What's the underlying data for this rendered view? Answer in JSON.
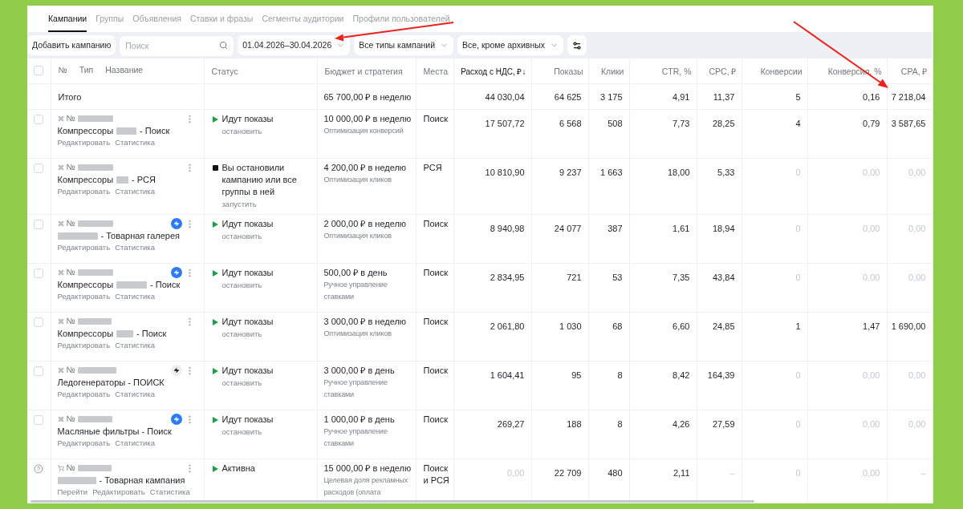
{
  "tabs": [
    {
      "label": "Кампании",
      "selected": true
    },
    {
      "label": "Группы",
      "selected": false
    },
    {
      "label": "Объявления",
      "selected": false
    },
    {
      "label": "Ставки и фразы",
      "selected": false
    },
    {
      "label": "Сегменты аудитории",
      "selected": false
    },
    {
      "label": "Профили пользователей",
      "selected": false
    }
  ],
  "toolbar": {
    "add_button": "Добавить кампанию",
    "search": {
      "placeholder": "Поиск"
    },
    "filters": [
      {
        "label": "01.04.2026–30.04.2026"
      },
      {
        "label": "Все типы кампаний"
      },
      {
        "label": "Все, кроме архивных"
      }
    ]
  },
  "table": {
    "all_checked": false,
    "name_column_labels": [
      "№",
      "Тип",
      "Название"
    ],
    "columns": [
      {
        "label": "Статус",
        "sorted": false
      },
      {
        "label": "Бюджет и стратегия",
        "sorted": false
      },
      {
        "label": "Места",
        "sorted": false
      },
      {
        "label": "Расход с НДС, ₽↓",
        "sorted": true
      },
      {
        "label": "Показы",
        "sorted": false
      },
      {
        "label": "Клики",
        "sorted": false
      },
      {
        "label": "CTR, %",
        "sorted": false
      },
      {
        "label": "CPC, ₽",
        "sorted": false
      },
      {
        "label": "Конверсии",
        "sorted": false
      },
      {
        "label": "Конверсия, %",
        "sorted": false
      },
      {
        "label": "CPA, ₽",
        "sorted": false
      }
    ],
    "totals": {
      "label": "Итого",
      "budget": "65 700,00 ₽ в неделю",
      "metrics": [
        {
          "text": "44 030,04",
          "muted": false
        },
        {
          "text": "64 625",
          "muted": false
        },
        {
          "text": "3 175",
          "muted": false
        },
        {
          "text": "4,91",
          "muted": false
        },
        {
          "text": "11,37",
          "muted": false
        },
        {
          "text": "5",
          "muted": false
        },
        {
          "text": "0,16",
          "muted": false
        },
        {
          "text": "7 218,04",
          "muted": false
        }
      ]
    },
    "rows": [
      {
        "kind": "text",
        "checked": false,
        "number": "№",
        "number_hidden": true,
        "name_parts": [
          {
            "kind": "text",
            "text": "Компрессоры"
          },
          {
            "kind": "hidden"
          },
          {
            "kind": "text",
            "text": "- Поиск"
          }
        ],
        "links": [
          "Редактировать",
          "Статистика"
        ],
        "status": {
          "kind": "running",
          "text": "Идут показы",
          "action": "остановить"
        },
        "budget": "10 000,00 ₽ в неделю",
        "strategy": "Оптимизация конверсий",
        "places": "Поиск",
        "metrics": [
          {
            "text": "17 507,72",
            "muted": false
          },
          {
            "text": "6 568",
            "muted": false
          },
          {
            "text": "508",
            "muted": false
          },
          {
            "text": "7,73",
            "muted": false
          },
          {
            "text": "28,25",
            "muted": false
          },
          {
            "text": "4",
            "muted": false
          },
          {
            "text": "0,79",
            "muted": false
          },
          {
            "text": "3 587,65",
            "muted": false
          }
        ]
      },
      {
        "kind": "text",
        "checked": false,
        "number": "№",
        "number_hidden": true,
        "name_parts": [
          {
            "kind": "text",
            "text": "Компрессоры"
          },
          {
            "kind": "hidden"
          },
          {
            "kind": "text",
            "text": "- РСЯ"
          }
        ],
        "links": [
          "Редактировать",
          "Статистика"
        ],
        "status": {
          "kind": "stopped",
          "text": "Вы остановили кампанию или все группы в ней",
          "action": "запустить"
        },
        "budget": "4 200,00 ₽ в неделю",
        "strategy": "Оптимизация кликов",
        "places": "РСЯ",
        "metrics": [
          {
            "text": "10 810,90",
            "muted": false
          },
          {
            "text": "9 237",
            "muted": false
          },
          {
            "text": "1 663",
            "muted": false
          },
          {
            "text": "18,00",
            "muted": false
          },
          {
            "text": "5,33",
            "muted": false
          },
          {
            "text": "0",
            "muted": true
          },
          {
            "text": "0,00",
            "muted": true
          },
          {
            "text": "0,00",
            "muted": true
          }
        ]
      },
      {
        "kind": "text",
        "checked": false,
        "number": "№",
        "number_hidden": true,
        "lightning": {
          "active": true
        },
        "name_parts": [
          {
            "kind": "hidden"
          },
          {
            "kind": "text",
            "text": "- Товарная галерея"
          }
        ],
        "links": [
          "Редактировать",
          "Статистика"
        ],
        "status": {
          "kind": "running",
          "text": "Идут показы",
          "action": "остановить"
        },
        "budget": "2 000,00 ₽ в неделю",
        "strategy": "Оптимизация кликов",
        "places": "Поиск",
        "metrics": [
          {
            "text": "8 940,98",
            "muted": false
          },
          {
            "text": "24 077",
            "muted": false
          },
          {
            "text": "387",
            "muted": false
          },
          {
            "text": "1,61",
            "muted": false
          },
          {
            "text": "18,94",
            "muted": false
          },
          {
            "text": "0",
            "muted": true
          },
          {
            "text": "0,00",
            "muted": true
          },
          {
            "text": "0,00",
            "muted": true
          }
        ]
      },
      {
        "kind": "text",
        "checked": false,
        "number": "№",
        "number_hidden": true,
        "lightning": {
          "active": true
        },
        "name_parts": [
          {
            "kind": "text",
            "text": "Компрессоры"
          },
          {
            "kind": "hidden"
          },
          {
            "kind": "text",
            "text": "- Поиск"
          }
        ],
        "links": [
          "Редактировать",
          "Статистика"
        ],
        "status": {
          "kind": "running",
          "text": "Идут показы",
          "action": "остановить"
        },
        "budget": "500,00 ₽ в день",
        "strategy": "Ручное управление ставками",
        "places": "Поиск",
        "metrics": [
          {
            "text": "2 834,95",
            "muted": false
          },
          {
            "text": "721",
            "muted": false
          },
          {
            "text": "53",
            "muted": false
          },
          {
            "text": "7,35",
            "muted": false
          },
          {
            "text": "43,84",
            "muted": false
          },
          {
            "text": "0",
            "muted": true
          },
          {
            "text": "0,00",
            "muted": true
          },
          {
            "text": "0,00",
            "muted": true
          }
        ]
      },
      {
        "kind": "text",
        "checked": false,
        "number": "№",
        "number_hidden": true,
        "name_parts": [
          {
            "kind": "text",
            "text": "Компрессоры"
          },
          {
            "kind": "hidden"
          },
          {
            "kind": "text",
            "text": "- Поиск"
          }
        ],
        "links": [
          "Редактировать",
          "Статистика"
        ],
        "status": {
          "kind": "running",
          "text": "Идут показы",
          "action": "остановить"
        },
        "budget": "3 000,00 ₽ в неделю",
        "strategy": "Оптимизация кликов",
        "places": "Поиск",
        "metrics": [
          {
            "text": "2 061,80",
            "muted": false
          },
          {
            "text": "1 030",
            "muted": false
          },
          {
            "text": "68",
            "muted": false
          },
          {
            "text": "6,60",
            "muted": false
          },
          {
            "text": "24,85",
            "muted": false
          },
          {
            "text": "1",
            "muted": false
          },
          {
            "text": "1,47",
            "muted": false
          },
          {
            "text": "1 690,00",
            "muted": false
          }
        ]
      },
      {
        "kind": "text",
        "checked": false,
        "number": "№",
        "number_hidden": true,
        "lightning": {
          "active": false
        },
        "name_parts": [
          {
            "kind": "text",
            "text": "Ледогенераторы - ПОИСК"
          }
        ],
        "links": [
          "Редактировать",
          "Статистика"
        ],
        "status": {
          "kind": "running",
          "text": "Идут показы",
          "action": "остановить"
        },
        "budget": "3 000,00 ₽ в день",
        "strategy": "Ручное управление ставками",
        "places": "Поиск",
        "metrics": [
          {
            "text": "1 604,41",
            "muted": false
          },
          {
            "text": "95",
            "muted": false
          },
          {
            "text": "8",
            "muted": false
          },
          {
            "text": "8,42",
            "muted": false
          },
          {
            "text": "164,39",
            "muted": false
          },
          {
            "text": "0",
            "muted": true
          },
          {
            "text": "0,00",
            "muted": true
          },
          {
            "text": "0,00",
            "muted": true
          }
        ]
      },
      {
        "kind": "text",
        "checked": false,
        "number": "№",
        "number_hidden": true,
        "lightning": {
          "active": true
        },
        "name_parts": [
          {
            "kind": "text",
            "text": "Масляные фильтры - Поиск"
          }
        ],
        "links": [
          "Редактировать",
          "Статистика"
        ],
        "status": {
          "kind": "running",
          "text": "Идут показы",
          "action": "остановить"
        },
        "budget": "1 000,00 ₽ в день",
        "strategy": "Ручное управление ставками",
        "places": "Поиск",
        "metrics": [
          {
            "text": "269,27",
            "muted": false
          },
          {
            "text": "188",
            "muted": false
          },
          {
            "text": "8",
            "muted": false
          },
          {
            "text": "4,26",
            "muted": false
          },
          {
            "text": "27,59",
            "muted": false
          },
          {
            "text": "0",
            "muted": true
          },
          {
            "text": "0,00",
            "muted": true
          },
          {
            "text": "0,00",
            "muted": true
          }
        ]
      },
      {
        "kind": "product",
        "number": "№",
        "number_hidden": true,
        "name_parts": [
          {
            "kind": "hidden"
          },
          {
            "kind": "text",
            "text": "- Товарная кампания"
          }
        ],
        "links": [
          "Перейти",
          "Редактировать",
          "Статистика"
        ],
        "status": {
          "kind": "running",
          "text": "Активна"
        },
        "budget": "15 000,00 ₽ в неделю",
        "strategy": "Целевая доля рекламных расходов (оплата",
        "places": "Поиск и РСЯ",
        "metrics": [
          {
            "text": "0,00",
            "muted": true
          },
          {
            "text": "22 709",
            "muted": false
          },
          {
            "text": "480",
            "muted": false
          },
          {
            "text": "2,11",
            "muted": false
          },
          {
            "text": "–",
            "muted": true
          },
          {
            "text": "0",
            "muted": true
          },
          {
            "text": "0,00",
            "muted": true
          },
          {
            "text": "–",
            "muted": true
          }
        ]
      }
    ]
  }
}
